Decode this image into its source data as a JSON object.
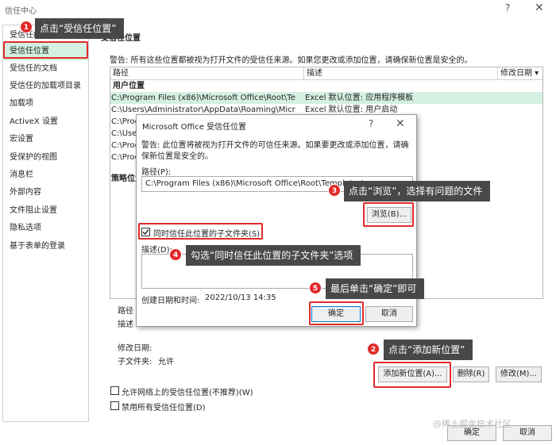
{
  "window": {
    "title": "信任中心",
    "help": "?",
    "close": "✕"
  },
  "sidebar": {
    "items": [
      {
        "label": "受信任的发布者"
      },
      {
        "label": "受信任位置"
      },
      {
        "label": "受信任的文档"
      },
      {
        "label": "受信任的加载项目录"
      },
      {
        "label": "加载项"
      },
      {
        "label": "ActiveX 设置"
      },
      {
        "label": "宏设置"
      },
      {
        "label": "受保护的视图"
      },
      {
        "label": "消息栏"
      },
      {
        "label": "外部内容"
      },
      {
        "label": "文件阻止设置"
      },
      {
        "label": "隐私选项"
      },
      {
        "label": "基于表单的登录"
      }
    ]
  },
  "main": {
    "header": "受信任位置",
    "warning": "警告: 所有这些位置都被视为打开文件的受信任来源。如果您更改或添加位置，请确保新位置是安全的。",
    "columns": {
      "path": "路径",
      "desc": "描述",
      "date": "修改日期 ▾"
    },
    "group_user": "用户位置",
    "group_policy": "策略位置",
    "rows": [
      {
        "path": "C:\\Program Files (x86)\\Microsoft Office\\Root\\Te",
        "desc": "Excel 默认位置: 应用程序模板"
      },
      {
        "path": "C:\\Users\\Administrator\\AppData\\Roaming\\Micr",
        "desc": "Excel 默认位置: 用户启动"
      },
      {
        "path": "C:\\Prog",
        "desc": ""
      },
      {
        "path": "C:\\Use",
        "desc": ""
      },
      {
        "path": "C:\\Prog",
        "desc": ""
      },
      {
        "path": "C:\\Prog",
        "desc": ""
      }
    ],
    "detail_path_label": "路径",
    "detail_desc_label": "描述",
    "date_label": "修改日期:",
    "subfolder_label": "子文件夹:",
    "subfolder_value": "允许",
    "add_button": "添加新位置(A)...",
    "remove_button": "删除(R)",
    "modify_button": "修改(M)...",
    "allow_network_label": "允许网络上的受信任位置(不推荐)(W)",
    "disable_all_label": "禁用所有受信任位置(D)",
    "ok_button": "确定",
    "cancel_button": "取消"
  },
  "dialog": {
    "title": "Microsoft Office 受信任位置",
    "help": "?",
    "close": "✕",
    "warning": "警告: 此位置将被视为打开文件的可信任来源。如果要更改或添加位置，请确保新位置是安全的。",
    "path_label": "路径(P):",
    "path_value": "C:\\Program Files (x86)\\Microsoft Office\\Root\\Templates\\",
    "browse_button": "浏览(B)...",
    "subfolder_check_label": "同时信任此位置的子文件夹(S)",
    "subfolder_checked": true,
    "desc_label": "描述(D):",
    "created_label": "创建日期和时间:",
    "created_value": "2022/10/13 14:35",
    "ok_button": "确定",
    "cancel_button": "取消"
  },
  "annotations": {
    "step1": {
      "num": "1",
      "text": "点击“受信任位置”"
    },
    "step2": {
      "num": "2",
      "text": "点击“添加新位置”"
    },
    "step3": {
      "num": "3",
      "text": "点击“浏览”，选择有问题的文件"
    },
    "step4": {
      "num": "4",
      "text": "勾选“同时信任此位置的子文件夹”选项"
    },
    "step5": {
      "num": "5",
      "text": "最后单击“确定”即可"
    }
  },
  "watermark": "@稀土掘金技术社区",
  "colors": {
    "selection": "#d3f0e0",
    "annotation_red": "#e32a2a",
    "callout_bg": "#484848"
  }
}
